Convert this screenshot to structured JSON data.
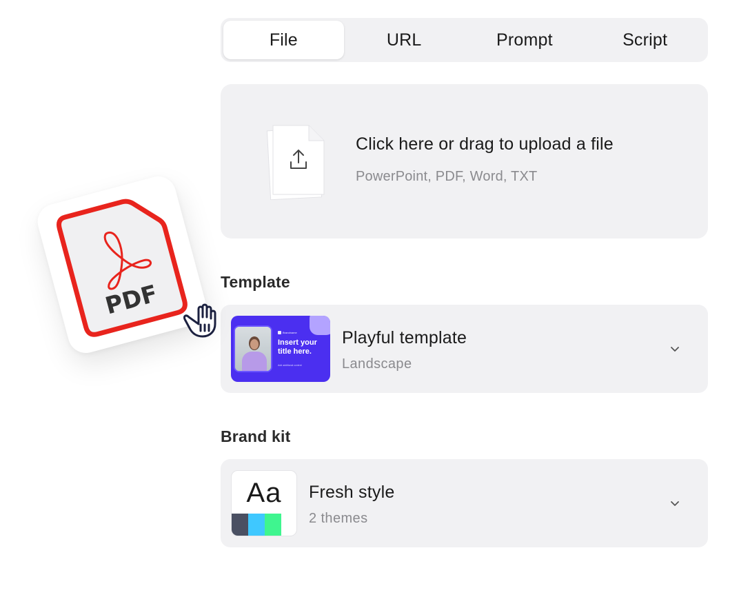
{
  "tabs": [
    {
      "label": "File",
      "active": true
    },
    {
      "label": "URL",
      "active": false
    },
    {
      "label": "Prompt",
      "active": false
    },
    {
      "label": "Script",
      "active": false
    }
  ],
  "upload": {
    "icon": "upload-file-icon",
    "title": "Click here or drag to upload a file",
    "subtitle": "PowerPoint, PDF, Word, TXT"
  },
  "template": {
    "section_label": "Template",
    "name": "Playful template",
    "orientation": "Landscape",
    "thumbnail": {
      "headline": "Insert your title here.",
      "brand": "Brandname",
      "subline": "Add additional content",
      "color": "#4b2ff0"
    },
    "chevron": "chevron-down-icon"
  },
  "brand_kit": {
    "section_label": "Brand kit",
    "name": "Fresh style",
    "themes": "2 themes",
    "sample_text": "Aa",
    "swatches": [
      "#4a5062",
      "#3fc8ff",
      "#3ff58f"
    ],
    "chevron": "chevron-down-icon"
  },
  "drag_item": {
    "label": "PDF",
    "icon": "pdf-file-icon",
    "cursor": "grab-hand-icon",
    "accent": "#e8241d"
  }
}
